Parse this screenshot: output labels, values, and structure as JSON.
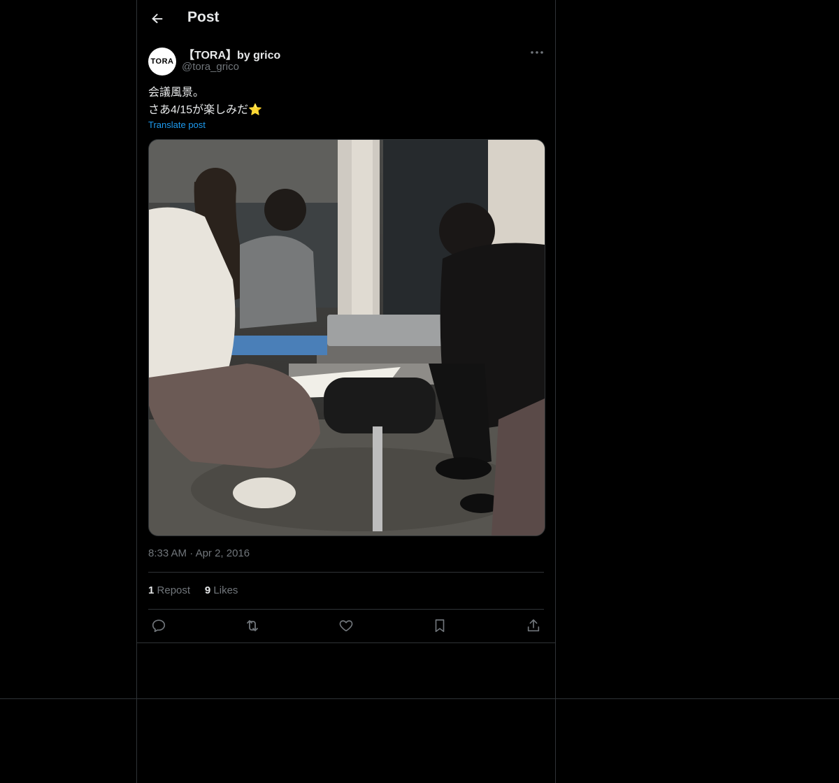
{
  "header": {
    "title": "Post",
    "back_icon": "arrow-left-icon"
  },
  "post": {
    "avatar_text": "TORA",
    "display_name": "【TORA】by grico",
    "handle": "@tora_grico",
    "text_line1": "会議風景。",
    "text_line2": "さあ4/15が楽しみだ",
    "emoji": "⭐",
    "translate_label": "Translate post",
    "image_alt": "photo",
    "time": "8:33 AM",
    "dot": "·",
    "date": "Apr 2, 2016",
    "reposts_count": "1",
    "reposts_label": "Repost",
    "likes_count": "9",
    "likes_label": "Likes"
  },
  "icons": [
    "arrow-left-icon",
    "more-icon",
    "reply-icon",
    "repost-icon",
    "like-icon",
    "bookmark-icon",
    "share-icon"
  ],
  "colors": {
    "background": "#000000",
    "text": "#e7e9ea",
    "secondary": "#71767b",
    "accent": "#1d9bf0",
    "border": "#2f3336"
  }
}
